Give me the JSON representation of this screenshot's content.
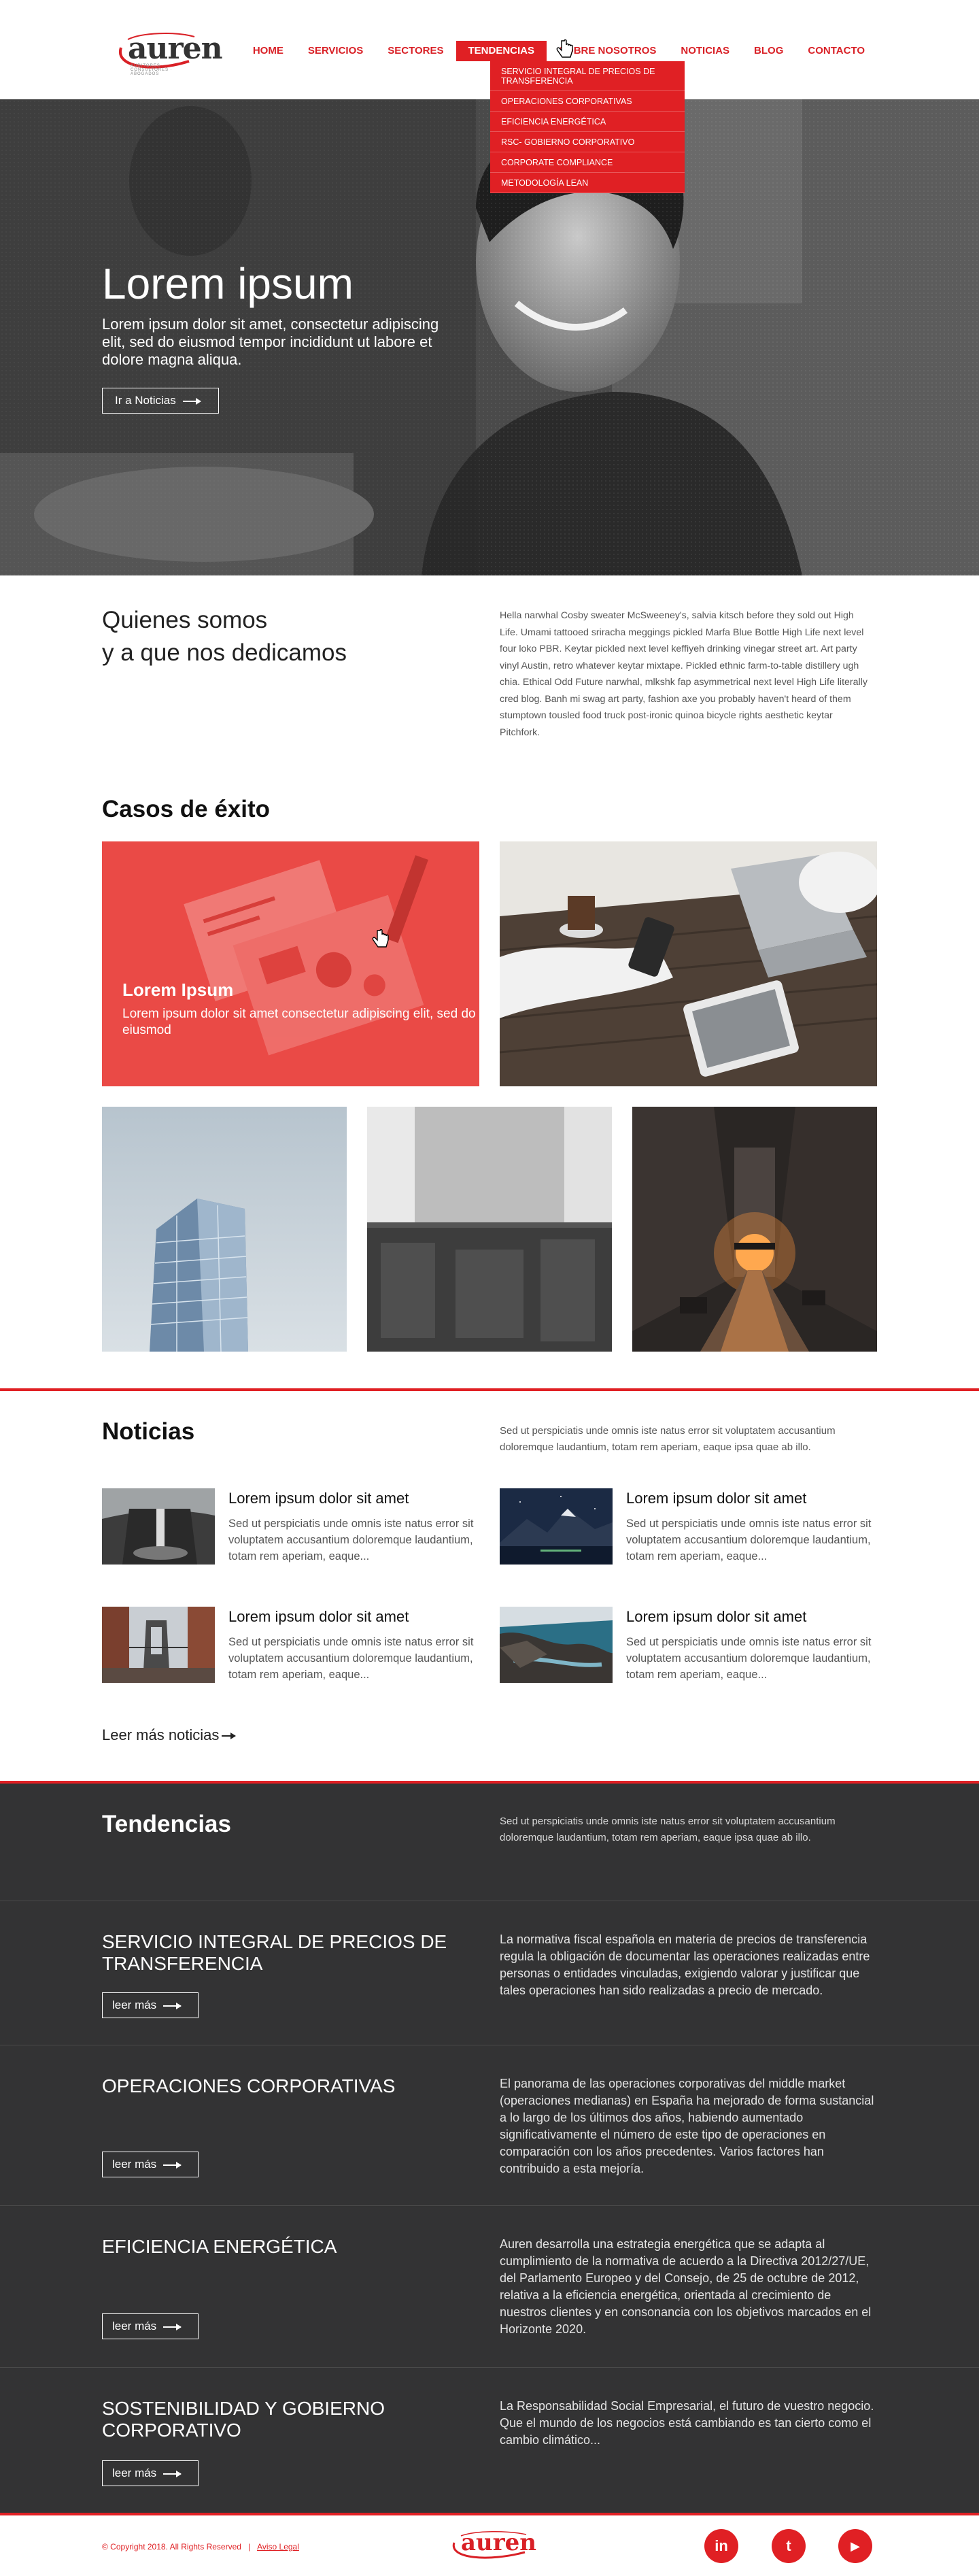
{
  "brand": {
    "logo_text": "auren",
    "logo_tag": "AUDITORES · CONSULTORES · ABOGADOS"
  },
  "nav": {
    "items": [
      "HOME",
      "SERVICIOS",
      "SECTORES",
      "TENDENCIAS",
      "SOBRE NOSOTROS",
      "NOTICIAS",
      "BLOG",
      "CONTACTO"
    ],
    "active": "TENDENCIAS",
    "dropdown": [
      "SERVICIO INTEGRAL DE PRECIOS DE TRANSFERENCIA",
      "OPERACIONES CORPORATIVAS",
      "EFICIENCIA ENERGÉTICA",
      "RSC- GOBIERNO CORPORATIVO",
      "CORPORATE COMPLIANCE",
      "METODOLOGÍA LEAN"
    ]
  },
  "hero": {
    "title": "Lorem ipsum",
    "subtitle": "Lorem ipsum dolor sit amet, consectetur adipiscing elit, sed do eiusmod tempor incididunt ut labore et dolore magna aliqua.",
    "button": "Ir a Noticias"
  },
  "about": {
    "title_line1": "Quienes somos",
    "title_line2": "y a que nos dedicamos",
    "text": "Hella narwhal Cosby sweater McSweeney's, salvia kitsch before they sold out High Life. Umami tattooed sriracha meggings pickled Marfa Blue Bottle High Life next level four loko PBR. Keytar pickled next level keffiyeh drinking vinegar street art. Art party vinyl Austin, retro whatever keytar mixtape. Pickled ethnic farm-to-table distillery ugh chia. Ethical Odd Future narwhal, mlkshk fap asymmetrical next level High Life literally cred blog. Banh mi swag art party, fashion axe you probably haven't heard of them stumptown tousled food truck post-ironic quinoa bicycle rights aesthetic keytar Pitchfork."
  },
  "casos": {
    "title": "Casos de éxito",
    "featured_title": "Lorem Ipsum",
    "featured_text": "Lorem ipsum dolor sit amet consectetur adipiscing elit, sed do eiusmod"
  },
  "noticias": {
    "title": "Noticias",
    "intro": "Sed ut perspiciatis unde omnis iste natus error sit voluptatem accusantium doloremque laudantium, totam rem aperiam, eaque ipsa quae ab illo.",
    "items": [
      {
        "title": "Lorem ipsum dolor sit amet",
        "text": "Sed ut perspiciatis unde omnis iste natus error sit voluptatem accusantium doloremque laudantium, totam rem aperiam, eaque..."
      },
      {
        "title": "Lorem ipsum dolor sit amet",
        "text": "Sed ut perspiciatis unde omnis iste natus error sit voluptatem accusantium doloremque laudantium, totam rem aperiam, eaque..."
      },
      {
        "title": "Lorem ipsum dolor sit amet",
        "text": "Sed ut perspiciatis unde omnis iste natus error sit voluptatem accusantium doloremque laudantium, totam rem aperiam, eaque..."
      },
      {
        "title": "Lorem ipsum dolor sit amet",
        "text": "Sed ut perspiciatis unde omnis iste natus error sit voluptatem accusantium doloremque laudantium, totam rem aperiam, eaque..."
      }
    ],
    "more": "Leer más noticias"
  },
  "tendencias": {
    "title": "Tendencias",
    "intro": "Sed ut perspiciatis unde omnis iste natus error sit voluptatem accusantium doloremque laudantium, totam rem aperiam, eaque ipsa quae ab illo.",
    "button": "leer más",
    "items": [
      {
        "title": "SERVICIO INTEGRAL DE PRECIOS DE TRANSFERENCIA",
        "text": "La normativa fiscal española en materia de precios de transferencia regula la obligación de documentar las operaciones realizadas entre personas o entidades vinculadas, exigiendo valorar y justificar que tales operaciones han sido realizadas a precio de mercado."
      },
      {
        "title": "OPERACIONES CORPORATIVAS",
        "text": "El panorama de las operaciones corporativas del middle market (operaciones medianas) en España ha mejorado de forma sustancial a lo largo de los últimos dos años, habiendo aumentado significativamente el número de este tipo de operaciones en comparación con los años precedentes. Varios factores han contribuido a esta mejoría."
      },
      {
        "title": "EFICIENCIA ENERGÉTICA",
        "text": "Auren desarrolla una estrategia energética que se adapta al cumplimiento de la normativa de acuerdo a la Directiva 2012/27/UE, del Parlamento Europeo y del Consejo, de 25 de octubre de 2012, relativa a la eficiencia energética, orientada al crecimiento de nuestros clientes y en consonancia con los objetivos marcados en el Horizonte 2020."
      },
      {
        "title": "SOSTENIBILIDAD Y GOBIERNO CORPORATIVO",
        "text": "La Responsabilidad Social Empresarial, el futuro de vuestro negocio. Que el mundo de los negocios está cambiando es tan cierto como el cambio climático..."
      }
    ]
  },
  "footer": {
    "copyright": "© Copyright 2018. All Rights Reserved",
    "separator": "|",
    "legal": "Aviso Legal",
    "social": [
      "in",
      "t",
      "▶"
    ]
  },
  "colors": {
    "accent": "#e02024",
    "dark": "#333334"
  }
}
